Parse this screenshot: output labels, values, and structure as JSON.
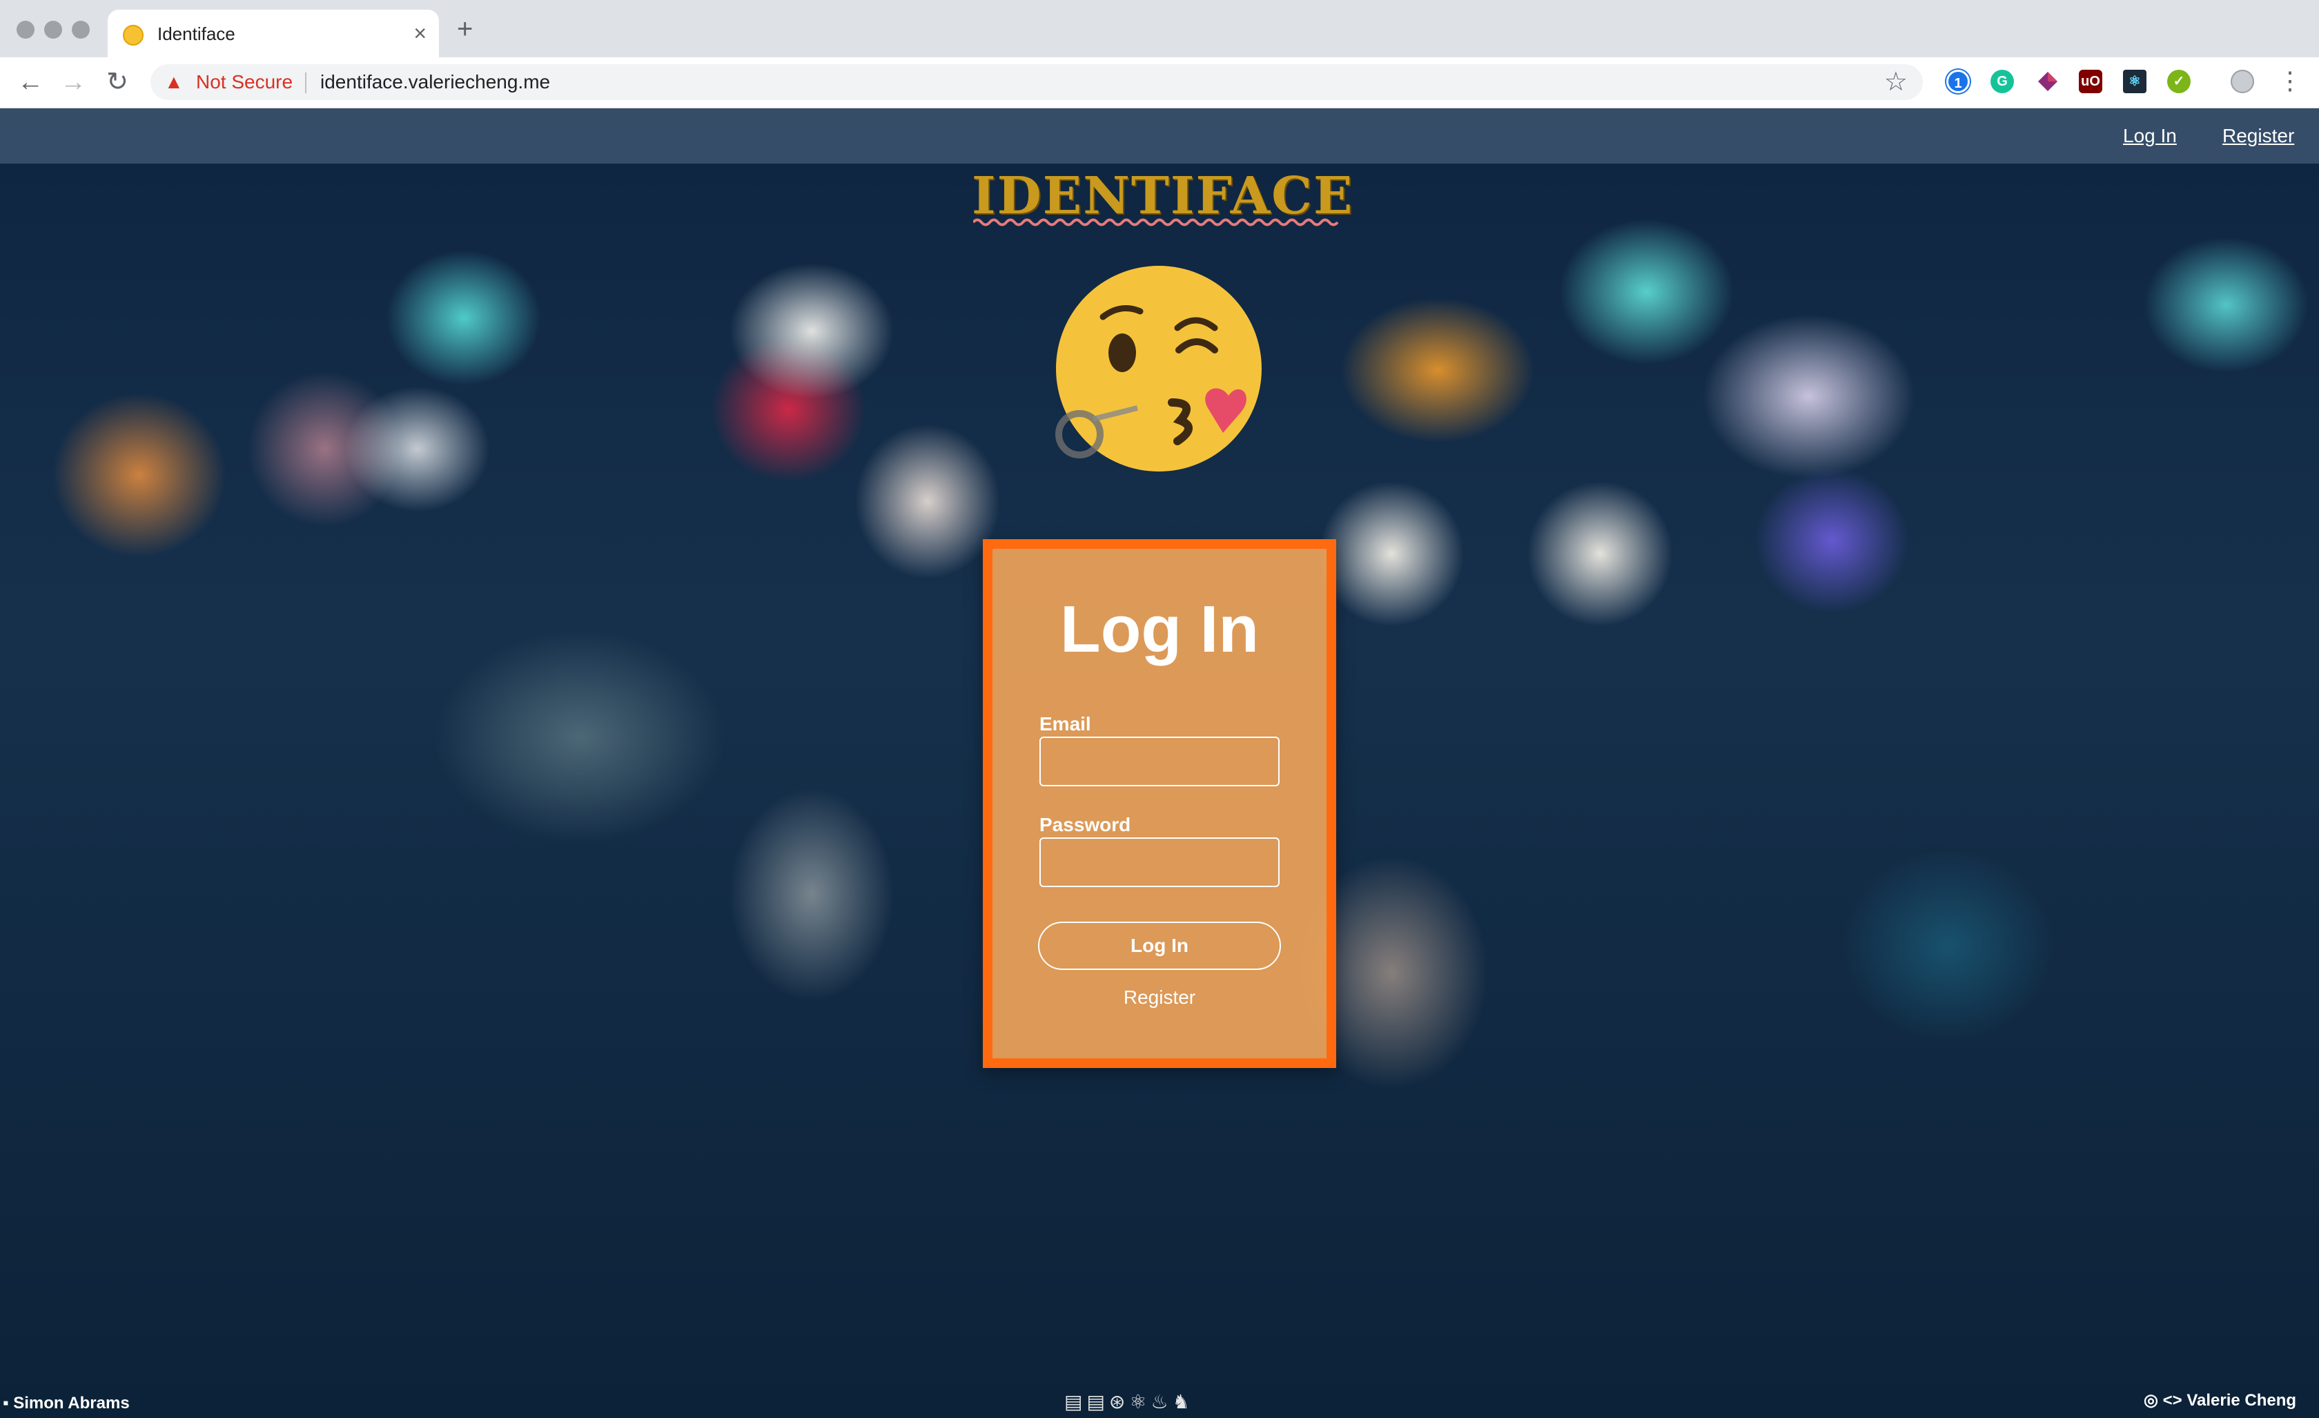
{
  "browser": {
    "tab_title": "Identiface",
    "tab_close": "×",
    "new_tab": "+",
    "back": "←",
    "forward": "→",
    "reload": "↻",
    "security_label": "Not Secure",
    "url": "identiface.valeriecheng.me",
    "bookmark_icon": "☆",
    "menu_icon": "⋮",
    "extension_icons": [
      "1password-icon",
      "grammarly-icon",
      "extension-icon",
      "ublock-icon",
      "react-devtools-icon",
      "check-extension-icon",
      "profile-avatar-icon"
    ]
  },
  "navbar": {
    "login_label": "Log In",
    "register_label": "Register"
  },
  "logo": {
    "text": "IDENTIFACE",
    "color": "#c99a1e"
  },
  "emoji": {
    "name": "face-blowing-a-kiss"
  },
  "login_card": {
    "title": "Log In",
    "email_label": "Email",
    "email_value": "",
    "password_label": "Password",
    "password_value": "",
    "submit_label": "Log In",
    "register_label": "Register",
    "border_color": "#ff6a10"
  },
  "footer": {
    "left_credit": "Simon Abrams",
    "tech_icons": "▤▤⊛⚛♨♞",
    "right_credit": "<> Valerie Cheng"
  }
}
